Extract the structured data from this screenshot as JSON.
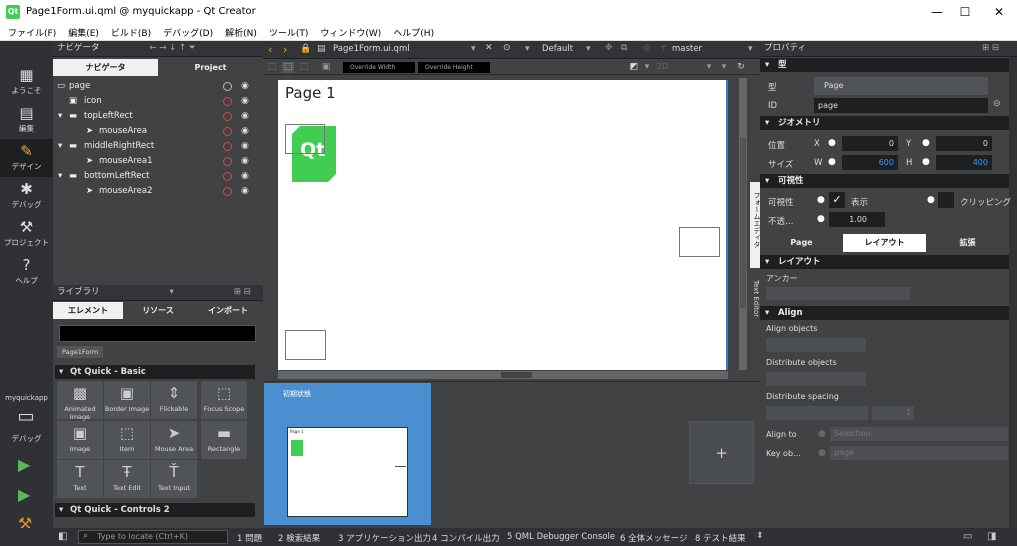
{
  "title_bar": {
    "app_icon": "Qt",
    "title": "Page1Form.ui.qml @ myquickapp - Qt Creator"
  },
  "menu": [
    "ファイル(F)",
    "編集(E)",
    "ビルド(B)",
    "デバッグ(D)",
    "解析(N)",
    "ツール(T)",
    "ウィンドウ(W)",
    "ヘルプ(H)"
  ],
  "modes": [
    {
      "label": "ようこそ",
      "icon": "grid-icon"
    },
    {
      "label": "編集",
      "icon": "edit-doc-icon"
    },
    {
      "label": "デザイン",
      "icon": "pencil-icon"
    },
    {
      "label": "デバッグ",
      "icon": "bug-icon"
    },
    {
      "label": "プロジェクト",
      "icon": "wrench-icon"
    },
    {
      "label": "ヘルプ",
      "icon": "help-icon"
    }
  ],
  "kit": {
    "project": "myquickapp",
    "mode": "デバッグ"
  },
  "navigator": {
    "title": "ナビゲータ",
    "tabs": [
      "ナビゲータ",
      "Project"
    ],
    "items": [
      {
        "name": "page",
        "indent": 0
      },
      {
        "name": "icon",
        "indent": 1
      },
      {
        "name": "topLeftRect",
        "indent": 1
      },
      {
        "name": "mouseArea",
        "indent": 2
      },
      {
        "name": "middleRightRect",
        "indent": 1
      },
      {
        "name": "mouseArea1",
        "indent": 2
      },
      {
        "name": "bottomLeftRect",
        "indent": 1
      },
      {
        "name": "mouseArea2",
        "indent": 2
      }
    ]
  },
  "library": {
    "title": "ライブラリ",
    "tabs": [
      "エレメント",
      "リソース",
      "インポート"
    ],
    "pageform_chip": "Page1Form",
    "section1": "Qt Quick - Basic",
    "section2": "Qt Quick - Controls 2",
    "items": [
      "Animated Image",
      "Border Image",
      "Flickable",
      "Focus Scope",
      "Image",
      "Item",
      "Mouse Area",
      "Rectangle",
      "Text",
      "Text Edit",
      "Text Input"
    ]
  },
  "editor": {
    "file": "Page1Form.ui.qml",
    "target": "Default",
    "branch": "master",
    "override_width": "Override Width",
    "override_height": "Override Height",
    "zoom": "2D",
    "page_title": "Page 1",
    "qt_logo": "Qt",
    "side_tabs": [
      "フォームエディタ",
      "Text Editor"
    ]
  },
  "states": {
    "base_state": "初期状態",
    "add": "+"
  },
  "properties": {
    "title": "プロパティ",
    "type_section": "型",
    "type_label": "型",
    "type_value": "Page",
    "id_label": "ID",
    "id_value": "page",
    "geometry_section": "ジオメトリ",
    "position_label": "位置",
    "x_label": "X",
    "x_value": "0",
    "y_label": "Y",
    "y_value": "0",
    "size_label": "サイズ",
    "w_label": "W",
    "w_value": "600",
    "h_label": "H",
    "h_value": "400",
    "visibility_section": "可視性",
    "visibility_label": "可視性",
    "visible_check": "表示",
    "clip_label": "クリッピング",
    "opacity_label": "不透…",
    "opacity_value": "1.00",
    "tabs": [
      "Page",
      "レイアウト",
      "拡張"
    ],
    "layout_section": "レイアウト",
    "anchor_label": "アンカー",
    "align_section": "Align",
    "align_objects": "Align objects",
    "distribute_objects": "Distribute objects",
    "distribute_spacing": "Distribute spacing",
    "spacing_value": "1",
    "align_to": "Align to",
    "align_to_value": "Selection",
    "key_object": "Key ob…",
    "key_object_value": "page"
  },
  "statusbar": {
    "locator_placeholder": "Type to locate (Ctrl+K)",
    "panes": [
      "1 問題",
      "2 検索結果",
      "3 アプリケーション出力",
      "4 コンパイル出力",
      "5 QML Debugger Console",
      "6 全体メッセージ",
      "8 テスト結果"
    ]
  },
  "colors": {
    "accent_blue": "#2c7ed6",
    "qt_green": "#41cd52",
    "state_blue": "#4a90d0",
    "visibility_red": "#e0464e"
  }
}
